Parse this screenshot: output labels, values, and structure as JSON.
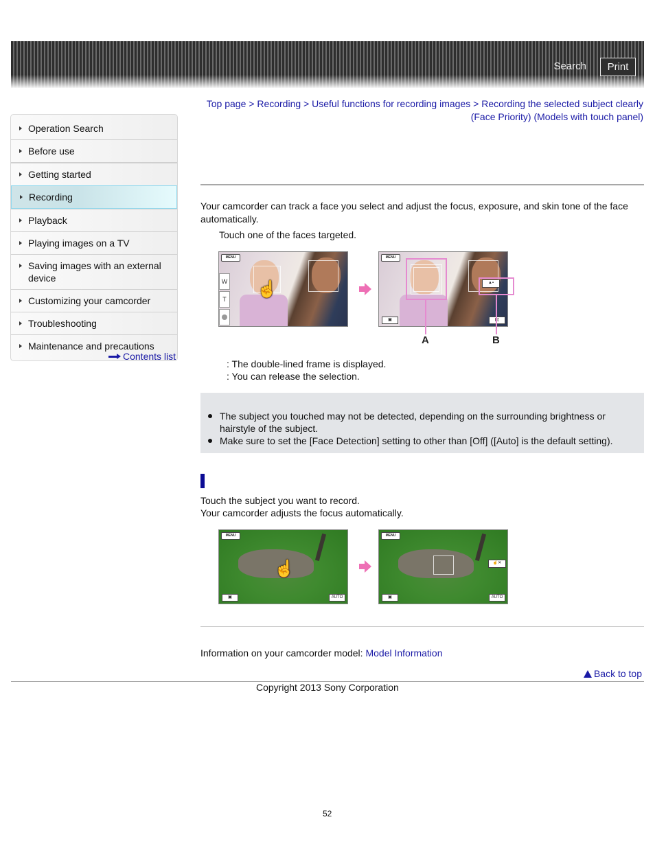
{
  "header": {
    "search_label": "Search",
    "print_label": "Print"
  },
  "sidebar": {
    "items": [
      {
        "label": "Operation Search"
      },
      {
        "label": "Before use"
      },
      {
        "label": "Getting started"
      },
      {
        "label": "Recording",
        "active": true
      },
      {
        "label": "Playback"
      },
      {
        "label": "Playing images on a TV"
      },
      {
        "label": "Saving images with an external device"
      },
      {
        "label": "Customizing your camcorder"
      },
      {
        "label": "Troubleshooting"
      },
      {
        "label": "Maintenance and precautions"
      }
    ],
    "contents_link": "Contents list"
  },
  "breadcrumb": {
    "items": [
      "Top page",
      "Recording",
      "Useful functions for recording images",
      "Recording the selected subject clearly (Face Priority) (Models with touch panel)"
    ],
    "separator": " > "
  },
  "main": {
    "intro": "Your camcorder can track a face you select and adjust the focus, exposure, and skin tone of the face automatically.",
    "step1": "Touch one of the faces targeted.",
    "figure1": {
      "menu_label": "MENU",
      "zoom_w": "W",
      "zoom_t": "T",
      "callout_a": "A",
      "callout_b": "B"
    },
    "legend": [
      ": The double-lined frame is displayed.",
      ": You can release the selection."
    ],
    "notes": [
      "The subject you touched may not be detected, depending on the surrounding brightness or hairstyle of the subject.",
      "Make sure to set the [Face Detection] setting to other than [Off] ([Auto] is the default setting)."
    ],
    "section2": {
      "line1": "Touch the subject you want to record.",
      "line2": "Your camcorder adjusts the focus automatically."
    },
    "figure2": {
      "menu_label": "MENU",
      "auto_label": "AUTO"
    },
    "model_info_prefix": "Information on your camcorder model: ",
    "model_info_link": "Model Information",
    "back_to_top": "Back to top"
  },
  "footer": {
    "copyright": "Copyright 2013 Sony Corporation",
    "page_number": "52"
  },
  "colors": {
    "link": "#1a1aa6",
    "active_nav": "#c9e3e8",
    "note_bg": "#e3e5e8",
    "subhead_bar": "#0b0b94",
    "callout_pink": "#e58ad0"
  }
}
